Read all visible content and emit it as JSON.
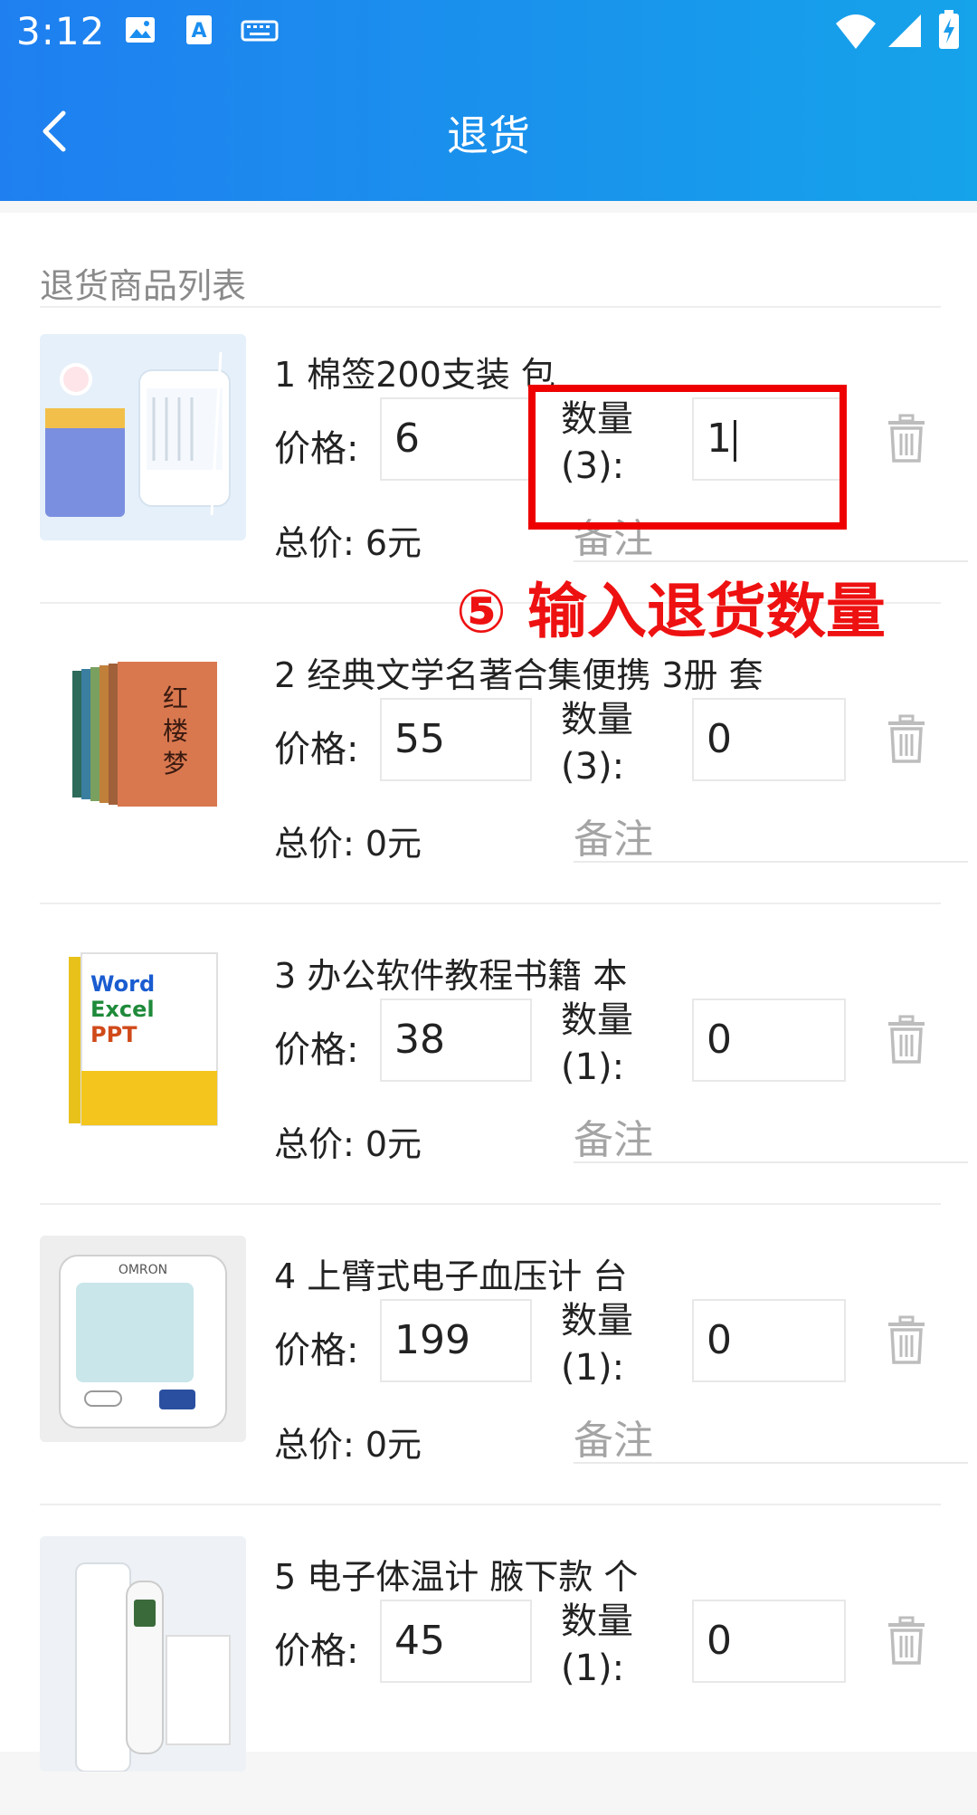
{
  "status_bar": {
    "time": "3:12"
  },
  "header": {
    "title": "退货"
  },
  "section": {
    "label": "退货商品列表"
  },
  "labels": {
    "price": "价格:",
    "remark": "备注"
  },
  "items": [
    {
      "name": "1 棉签200支装   包",
      "price": "6",
      "qty_label": "数量\n(3):",
      "qty": "1",
      "total": "总价: 6元"
    },
    {
      "name": "2 经典文学名著合集便携 3册  套",
      "price": "55",
      "qty_label": "数量\n(3):",
      "qty": "0",
      "total": "总价: 0元"
    },
    {
      "name": "3 办公软件教程书籍   本",
      "price": "38",
      "qty_label": "数量\n(1):",
      "qty": "0",
      "total": "总价: 0元"
    },
    {
      "name": "4 上臂式电子血压计   台",
      "price": "199",
      "qty_label": "数量\n(1):",
      "qty": "0",
      "total": "总价: 0元"
    },
    {
      "name": "5 电子体温计 腋下款  个",
      "price": "45",
      "qty_label": "数量\n(1):",
      "qty": "0",
      "total": ""
    }
  ],
  "annotation": {
    "text": "⑤ 输入退货数量"
  },
  "colors": {
    "header_start": "#1f7ff0",
    "header_end": "#15a3ea",
    "highlight": "#ee0000"
  }
}
